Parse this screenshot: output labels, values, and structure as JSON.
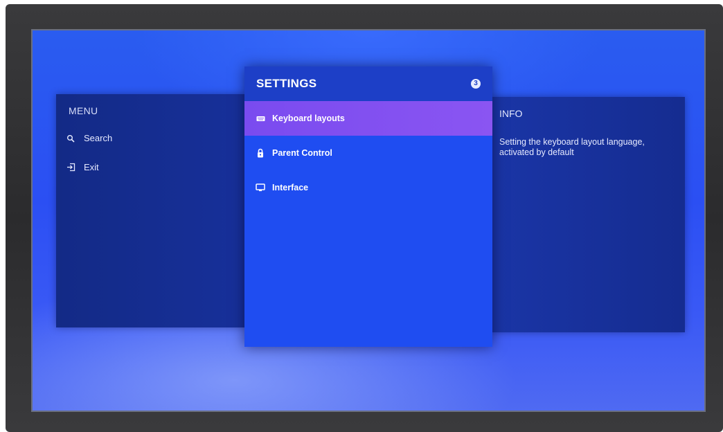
{
  "menu": {
    "title": "MENU",
    "items": [
      {
        "label": "Search",
        "icon": "search-icon"
      },
      {
        "label": "Exit",
        "icon": "exit-icon"
      }
    ]
  },
  "settings": {
    "title": "SETTINGS",
    "badge": "3",
    "items": [
      {
        "label": "Keyboard layouts",
        "icon": "keyboard-icon",
        "selected": true
      },
      {
        "label": "Parent Control",
        "icon": "lock-icon",
        "selected": false
      },
      {
        "label": "Interface",
        "icon": "monitor-icon",
        "selected": false
      }
    ]
  },
  "info": {
    "title": "INFO",
    "text": "Setting the keyboard layout language, activated by default"
  },
  "colors": {
    "selected_item": "#8050F0",
    "screen_blue": "#2B50F3"
  }
}
